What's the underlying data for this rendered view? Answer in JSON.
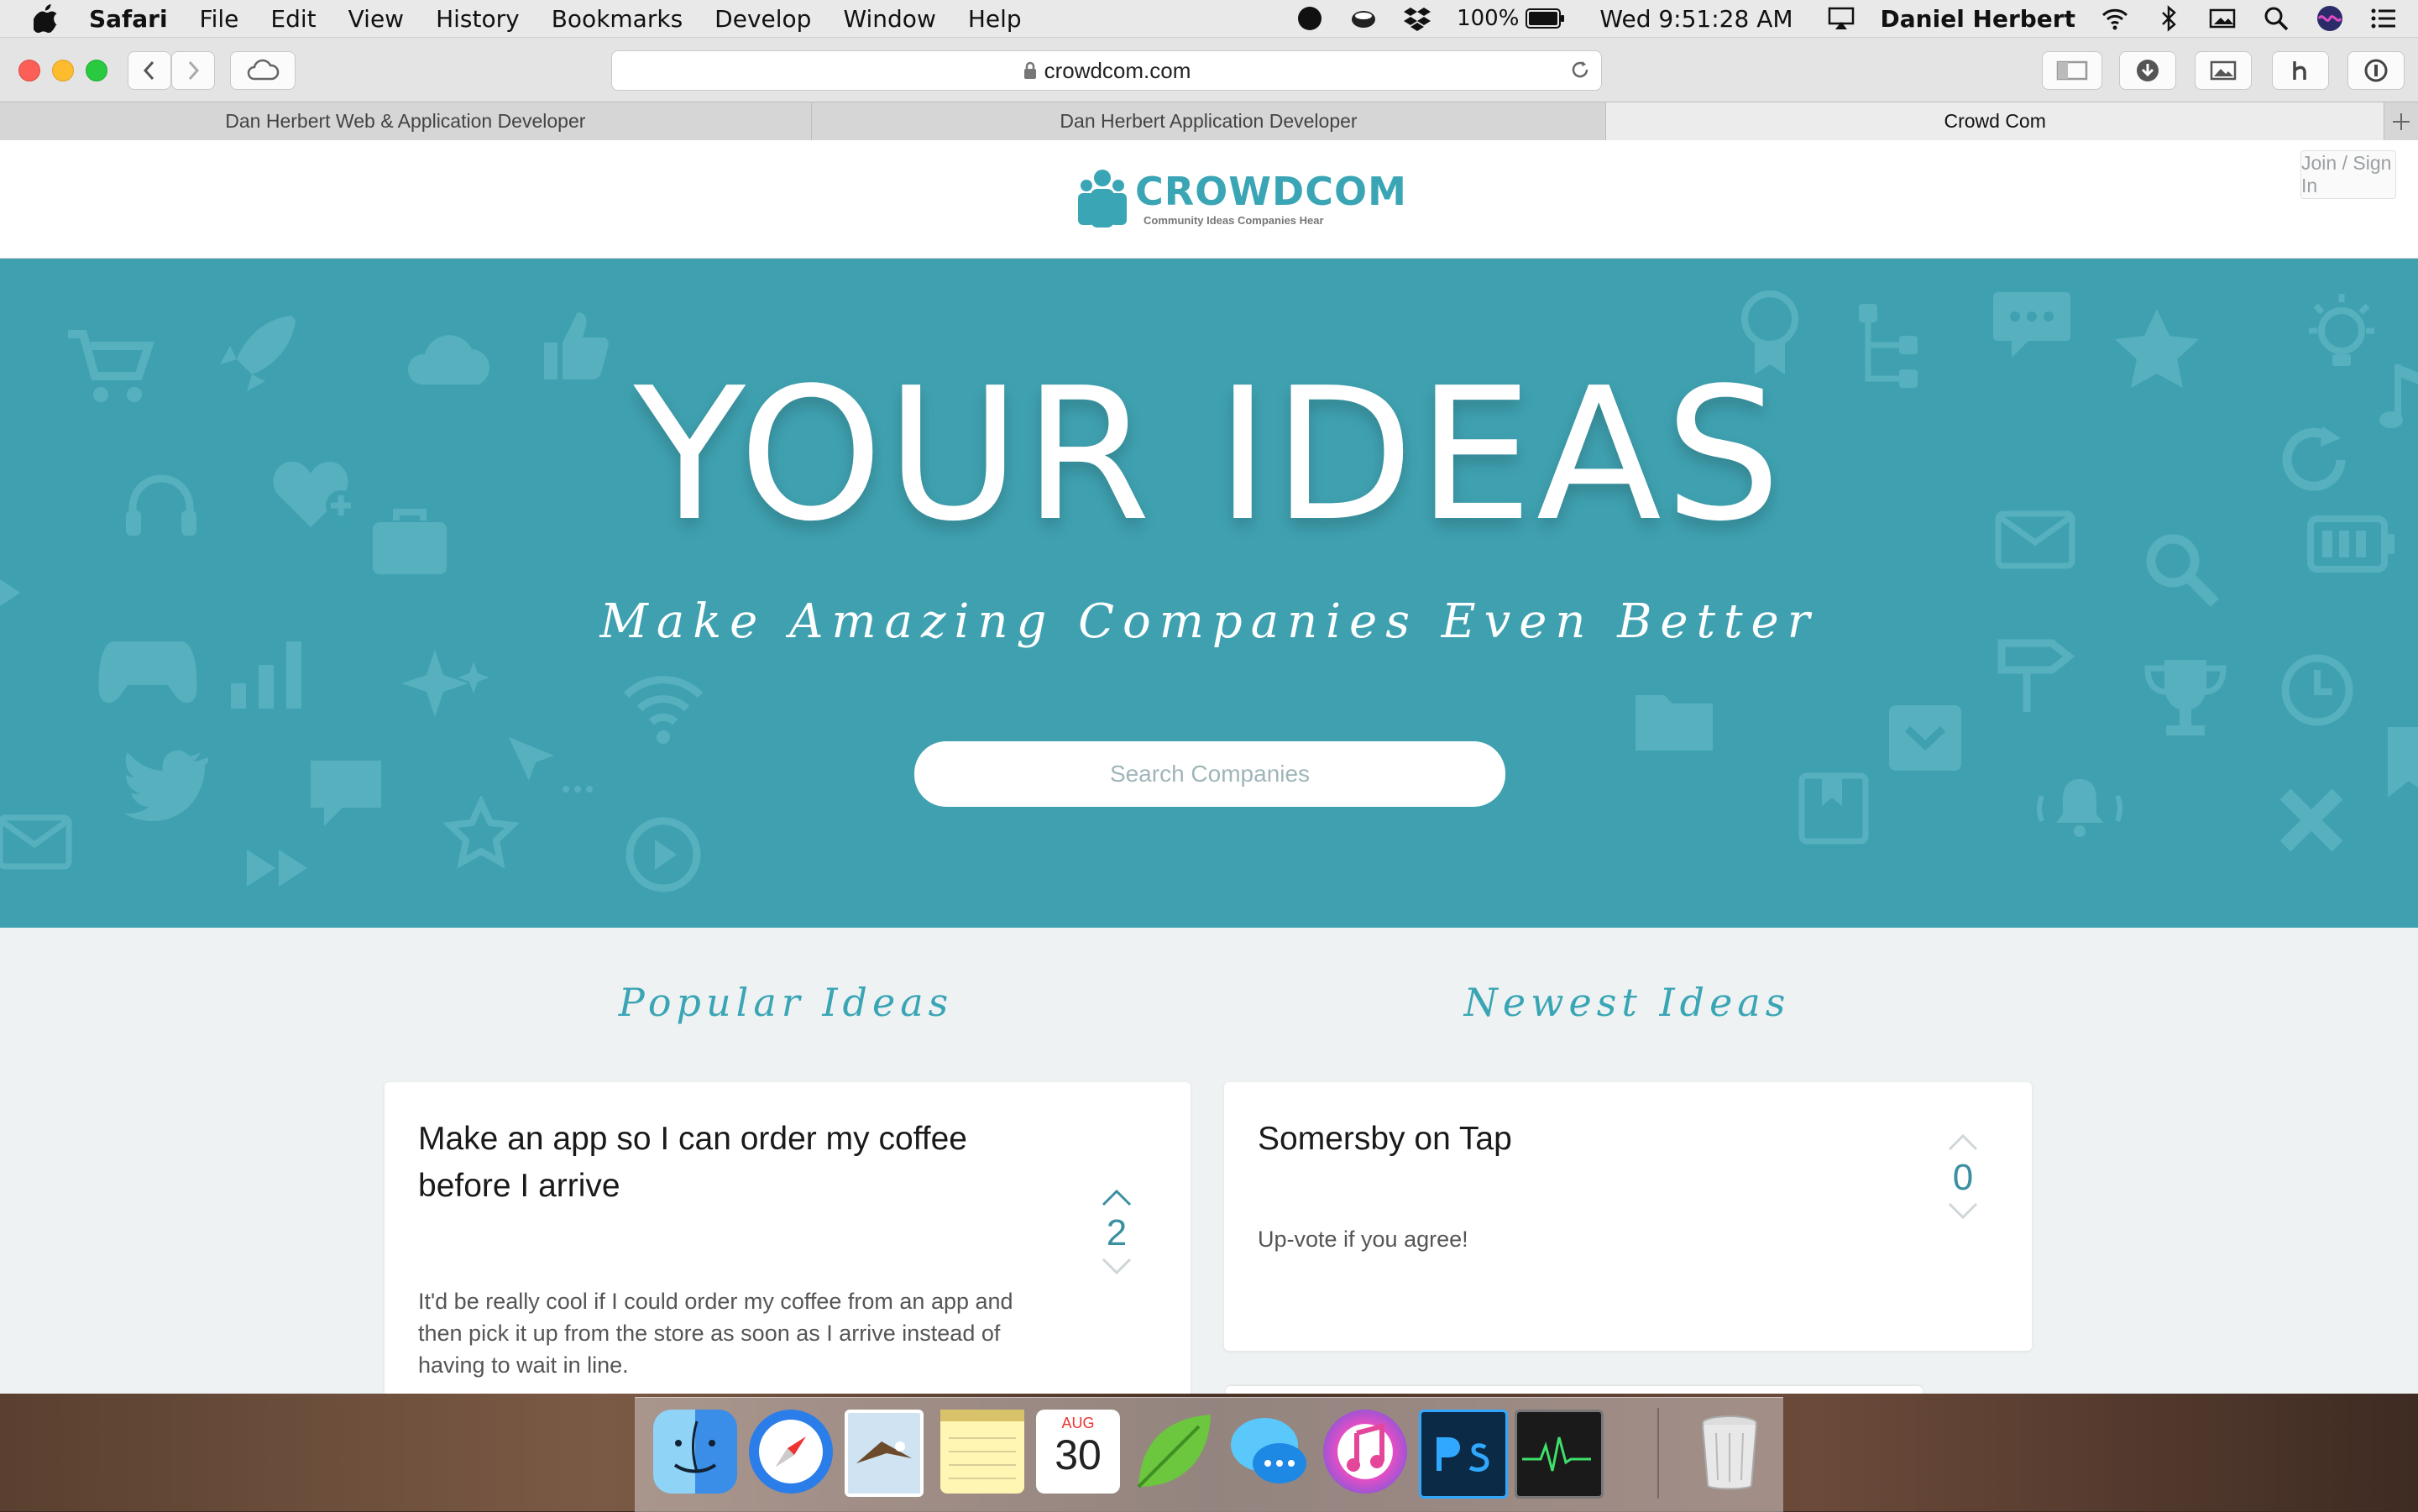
{
  "menubar": {
    "app": "Safari",
    "items": [
      "File",
      "Edit",
      "View",
      "History",
      "Bookmarks",
      "Develop",
      "Window",
      "Help"
    ],
    "battery": "100%",
    "clock": "Wed 9:51:28 AM",
    "user": "Daniel Herbert"
  },
  "browser": {
    "url": "crowdcom.com",
    "tabs": [
      {
        "label": "Dan Herbert Web & Application Developer"
      },
      {
        "label": "Dan Herbert Application Developer"
      },
      {
        "label": "Crowd Com"
      }
    ]
  },
  "site": {
    "logo_name": "CROWDCOM",
    "logo_tagline": "Community Ideas Companies Hear",
    "signin_label": "Join / Sign In",
    "hero_title": "YOUR IDEAS",
    "hero_subtitle": "Make Amazing Companies Even Better",
    "search_placeholder": "Search Companies",
    "popular_title": "Popular Ideas",
    "newest_title": "Newest Ideas",
    "popular_card": {
      "title_line1": "Make an app so I can order my coffee",
      "title_line2": "before I arrive",
      "votes": "2",
      "desc_line1": "It'd be really cool if I could order my coffee from an app and",
      "desc_line2": "then pick it up from the store as soon as I arrive instead of",
      "desc_line3": "having to wait in line."
    },
    "newest_card": {
      "title": "Somersby on Tap",
      "votes": "0",
      "desc": "Up-vote if you agree!"
    }
  },
  "dock": {
    "calendar_month": "AUG",
    "calendar_day": "30",
    "icons": [
      "finder-icon",
      "safari-icon",
      "mail-icon",
      "notes-icon",
      "calendar-icon",
      "coda-icon",
      "messages-icon",
      "itunes-icon",
      "photoshop-icon",
      "activity-monitor-icon",
      "trash-icon"
    ]
  },
  "colors": {
    "brand": "#3aa5b5",
    "hero_bg": "#3fa1b0",
    "vote_count": "#3a8fa1"
  }
}
